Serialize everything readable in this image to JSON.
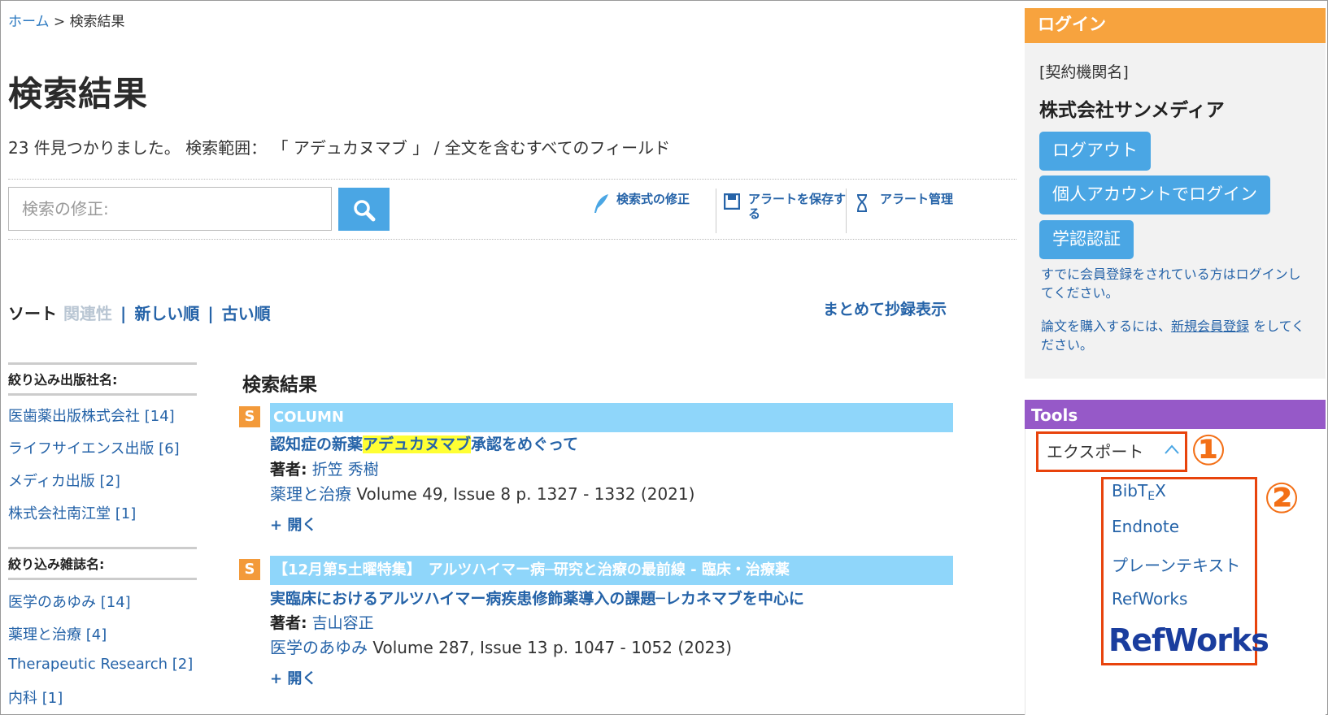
{
  "breadcrumb": {
    "home": "ホーム",
    "separator": ">",
    "current": "検索結果"
  },
  "page_title": "検索結果",
  "summary": "23 件見つかりました。 検索範囲： 「 アデュカヌマブ 」 / 全文を含むすべてのフィールド",
  "search": {
    "placeholder": "検索の修正:",
    "value": ""
  },
  "toolbar": {
    "modify_label": "検索式の修正",
    "save_alert_label_1": "アラートを保存す",
    "save_alert_label_2": "る",
    "alert_manage_label": "アラート管理"
  },
  "sort": {
    "label": "ソート",
    "relevance": "関連性",
    "separator": "|",
    "newest": "新しい順",
    "oldest": "古い順"
  },
  "bulk_abstract": "まとめて抄録表示",
  "facets": {
    "publisher": {
      "title": "絞り込み出版社名:",
      "items": [
        "医歯薬出版株式会社 [14]",
        "ライフサイエンス出版 [6]",
        "メディカ出版 [2]",
        "株式会社南江堂 [1]"
      ]
    },
    "journal": {
      "title": "絞り込み雑誌名:",
      "items": [
        "医学のあゆみ [14]",
        "薬理と治療 [4]",
        "Therapeutic Research [2]",
        "内科 [1]"
      ]
    }
  },
  "results": {
    "title": "検索結果",
    "items": [
      {
        "badge": "S",
        "section": "COLUMN",
        "title_pre": "認知症の新薬",
        "title_hl": "アデュカヌマブ",
        "title_post": "承認をめぐって",
        "author_label": "著者:",
        "author": "折笠 秀樹",
        "journal": "薬理と治療",
        "citation": " Volume 49, Issue 8 p. 1327 - 1332 (2021)",
        "open": "+ 開く"
      },
      {
        "badge": "S",
        "section": "【12月第5土曜特集】　アルツハイマー病─研究と治療の最前線 - 臨床・治療薬",
        "title": "実臨床におけるアルツハイマー病疾患修飾薬導入の課題─レカネマブを中心に",
        "author_label": "著者:",
        "author": "吉山容正",
        "journal": "医学のあゆみ",
        "citation": " Volume 287, Issue 13 p. 1047 - 1052 (2023)",
        "open": "+ 開く"
      }
    ]
  },
  "login": {
    "header": "ログイン",
    "org_label": "[契約機関名]",
    "org_name": "株式会社サンメディア",
    "logout": "ログアウト",
    "personal_login": "個人アカウントでログイン",
    "academic_auth": "学認認証",
    "note1": "すでに会員登録をされている方はログインしてください。",
    "note2_pre": "論文を購入するには、",
    "note2_link": "新規会員登録",
    "note2_post": " をしてください。"
  },
  "tools": {
    "header": "Tools",
    "export_label": "エクスポート",
    "marker1": "①",
    "marker2": "②",
    "export_options": {
      "bibtex_a": "BibT",
      "bibtex_sub": "E",
      "bibtex_b": "X",
      "endnote": "Endnote",
      "plain_text": "プレーンテキスト",
      "refworks": "RefWorks",
      "refworks_logo": "RefWorks"
    }
  },
  "colors": {
    "accent_blue": "#4aa6e4",
    "link_blue": "#2563a8",
    "login_orange": "#f7a33e",
    "tools_purple": "#9659c8",
    "annotation_red": "#e8430c",
    "section_bar": "#8fd6fa",
    "highlight": "#ffff33"
  }
}
